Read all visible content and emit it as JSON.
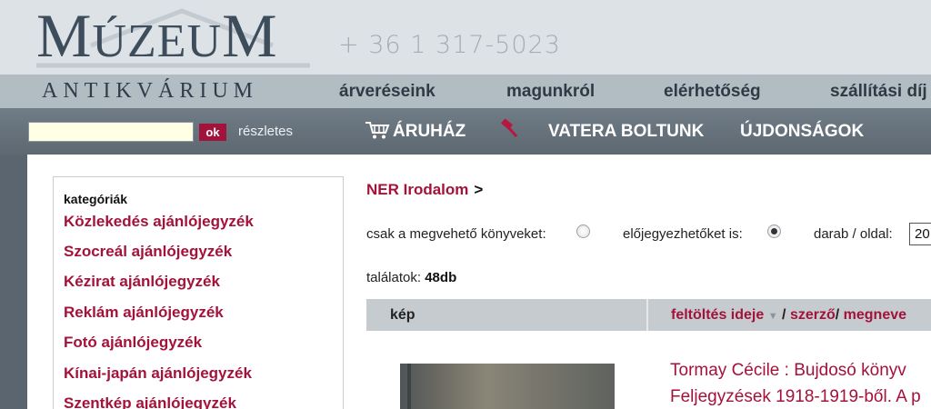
{
  "header": {
    "logo_main_1": "M",
    "logo_main_2": "ÚZEU",
    "logo_main_3": "M",
    "logo_sub": "ANTIKVÁRIUM",
    "phone": "+ 36 1 317-5023"
  },
  "topnav": [
    "árveréseink",
    "magunkról",
    "elérhetőség",
    "szállítási díj"
  ],
  "search": {
    "placeholder": "",
    "button": "ok",
    "advanced": "részletes"
  },
  "mainnav": {
    "shop": "ÁRUHÁZ",
    "vatera": "VATERA BOLTUNK",
    "news": "ÚJDONSÁGOK"
  },
  "sidebar": {
    "title": "kategóriák",
    "items": [
      "Közlekedés ajánlójegyzék",
      "Szocreál ajánlójegyzék",
      "Kézirat ajánlójegyzék",
      "Reklám ajánlójegyzék",
      "Fotó ajánlójegyzék",
      "Kínai-japán ajánlójegyzék",
      "Szentkép ajánlójegyzék"
    ]
  },
  "main": {
    "breadcrumb": "NER Irodalom",
    "breadcrumb_sep": ">",
    "filter_available": "csak a megvehető könyveket:",
    "filter_preorder": "előjegyezhetőket is:",
    "per_page_label": "darab / oldal:",
    "per_page_value": "20",
    "results_label": "találatok:",
    "results_count": "48db",
    "table": {
      "col_image": "kép",
      "sort_upload": "feltöltés ideje",
      "sort_author": "szerző",
      "sort_title": "megneve",
      "slash": "/"
    },
    "book": {
      "line1": "Tormay Cécile : Bujdosó könyv",
      "line2": "Feljegyzések 1918-1919-ből. A p"
    }
  },
  "colors": {
    "accent": "#a3123a",
    "header_bg": "#dde2e6",
    "nav_bg": "#b2bcc3",
    "bar_bg": "#6a757e"
  }
}
